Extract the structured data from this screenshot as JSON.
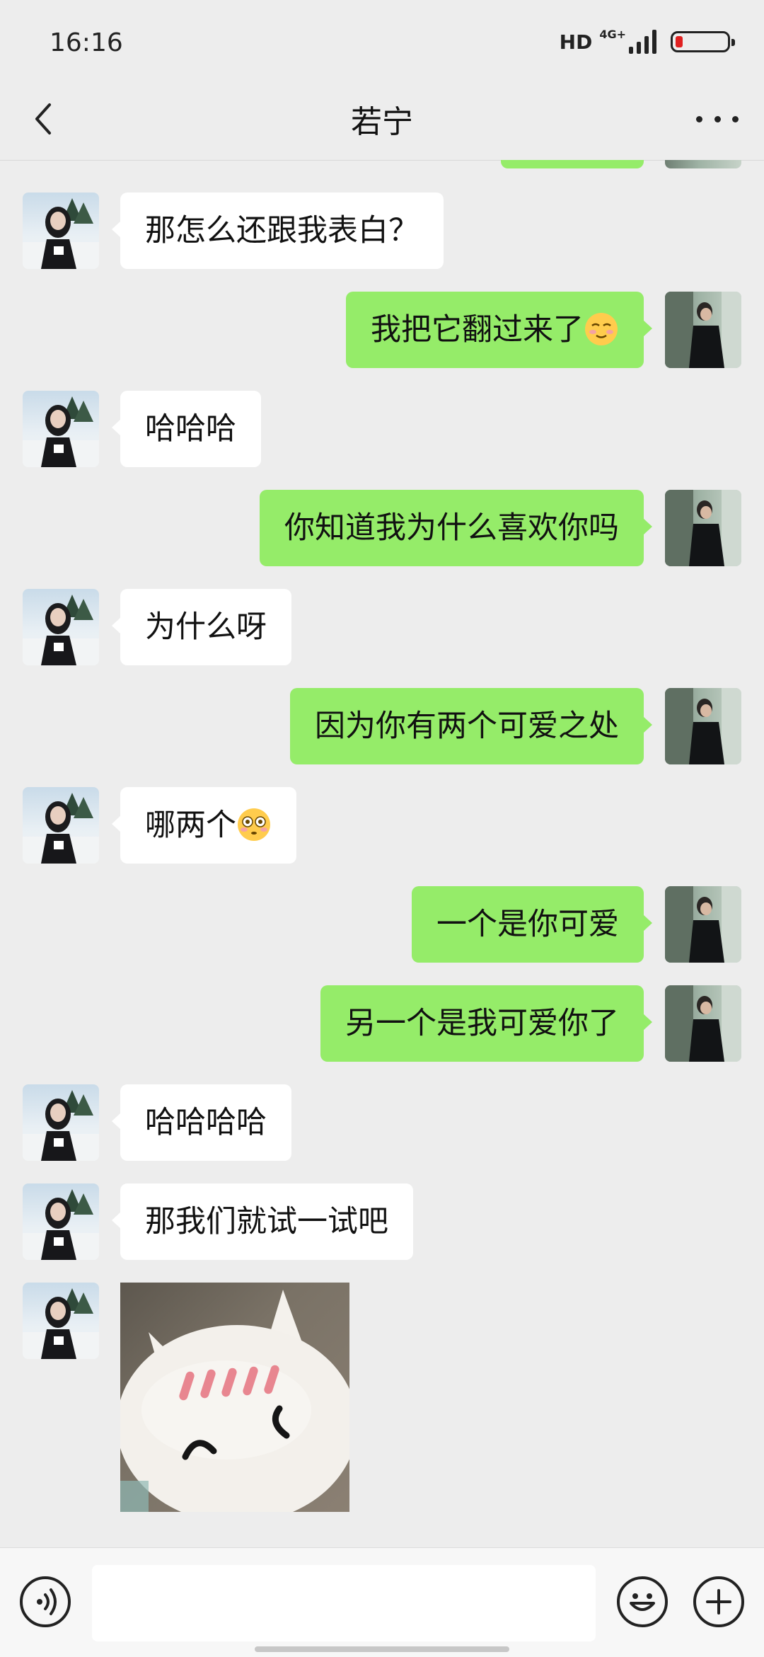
{
  "status_bar": {
    "time": "16:16",
    "network": "HD",
    "network_type": "4G+"
  },
  "header": {
    "title": "若宁"
  },
  "messages": [
    {
      "side": "left",
      "text": "那怎么还跟我表白？"
    },
    {
      "side": "right",
      "text": "我把它翻过来了",
      "emoji": "smiling-blush-emoji"
    },
    {
      "side": "left",
      "text": "哈哈哈"
    },
    {
      "side": "right",
      "text": "你知道我为什么喜欢你吗"
    },
    {
      "side": "left",
      "text": "为什么呀"
    },
    {
      "side": "right",
      "text": "因为你有两个可爱之处"
    },
    {
      "side": "left",
      "text": "哪两个",
      "emoji": "flushed-face-emoji"
    },
    {
      "side": "right",
      "text": "一个是你可爱"
    },
    {
      "side": "right",
      "text": "另一个是我可爱你了"
    },
    {
      "side": "left",
      "text": "哈哈哈哈"
    },
    {
      "side": "left",
      "text": "那我们就试一试吧"
    },
    {
      "side": "left",
      "sticker": "blushing-white-cat-sticker"
    }
  ],
  "input": {
    "value": "",
    "placeholder": ""
  },
  "colors": {
    "sent_bubble": "#95ec69",
    "received_bubble": "#ffffff",
    "background": "#ededed",
    "battery_low": "#e02020"
  },
  "icons": [
    "back-arrow-icon",
    "more-dots-icon",
    "voice-icon",
    "emoji-icon",
    "plus-icon"
  ]
}
